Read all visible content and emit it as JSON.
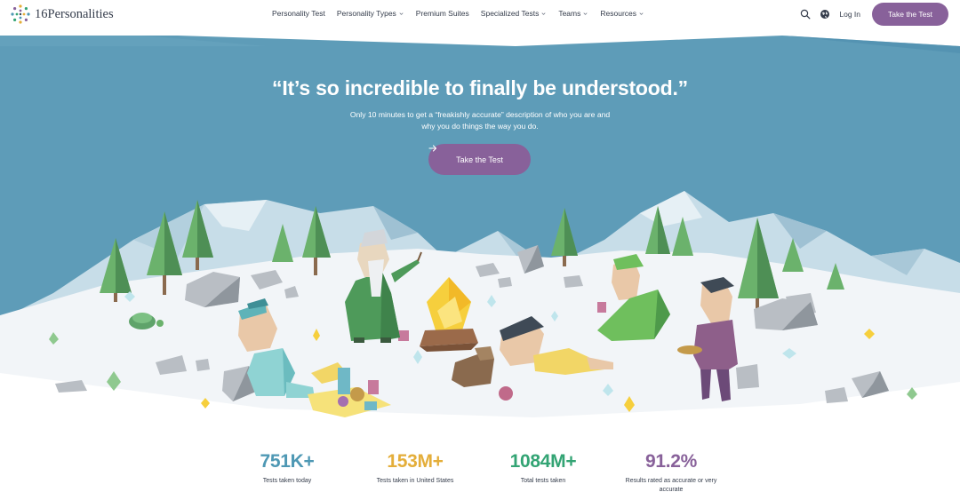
{
  "brand": {
    "name": "16Personalities"
  },
  "nav": {
    "items": [
      {
        "label": "Personality Test",
        "has_dropdown": false
      },
      {
        "label": "Personality Types",
        "has_dropdown": true
      },
      {
        "label": "Premium Suites",
        "has_dropdown": false
      },
      {
        "label": "Specialized Tests",
        "has_dropdown": true
      },
      {
        "label": "Teams",
        "has_dropdown": true
      },
      {
        "label": "Resources",
        "has_dropdown": true
      }
    ],
    "search_icon": "search-icon",
    "language_icon": "globe-icon",
    "login_label": "Log In",
    "cta_label": "Take the Test"
  },
  "hero": {
    "headline": "“It’s so incredible to finally be understood.”",
    "subline": "Only 10 minutes to get a “freakishly accurate” description of who you are and why you do things the way you do.",
    "cta_label": "Take the Test",
    "cta_icon": "arrow-right-icon"
  },
  "stats": [
    {
      "value": "751K+",
      "label": "Tests taken today",
      "color": "#4e98b4"
    },
    {
      "value": "153M+",
      "label": "Tests taken in United States",
      "color": "#e4ae3a"
    },
    {
      "value": "1084M+",
      "label": "Total tests taken",
      "color": "#33a474"
    },
    {
      "value": "91.2%",
      "label": "Results rated as accurate or very accurate",
      "color": "#88619a"
    }
  ],
  "colors": {
    "accent": "#88619a",
    "sky": "#5e9cb8",
    "text": "#343c4b"
  }
}
